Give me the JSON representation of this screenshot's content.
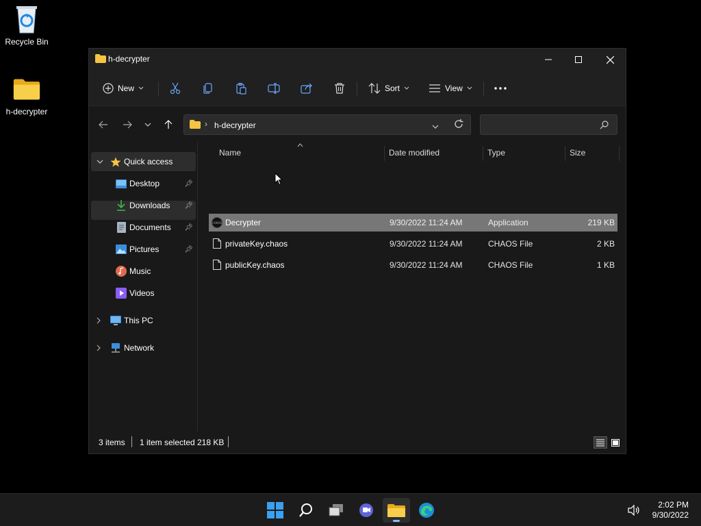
{
  "desktop": {
    "icons": [
      {
        "label": "Recycle Bin"
      },
      {
        "label": "h-decrypter"
      }
    ]
  },
  "window": {
    "title": "h-decrypter",
    "controls": {
      "minimize": "minimize-icon",
      "maximize": "maximize-icon",
      "close": "close-icon"
    }
  },
  "toolbar": {
    "new_label": "New",
    "sort_label": "Sort",
    "view_label": "View"
  },
  "address": {
    "path": "h-decrypter",
    "search_placeholder": ""
  },
  "nav": {
    "quick_access": "Quick access",
    "items": [
      {
        "label": "Desktop",
        "pinned": true
      },
      {
        "label": "Downloads",
        "pinned": true
      },
      {
        "label": "Documents",
        "pinned": true
      },
      {
        "label": "Pictures",
        "pinned": true
      },
      {
        "label": "Music",
        "pinned": false
      },
      {
        "label": "Videos",
        "pinned": false
      }
    ],
    "this_pc": "This PC",
    "network": "Network"
  },
  "columns": {
    "name": "Name",
    "date": "Date modified",
    "type": "Type",
    "size": "Size"
  },
  "files": [
    {
      "name": "Decrypter",
      "date": "9/30/2022 11:24 AM",
      "type": "Application",
      "size": "219 KB",
      "selected": true
    },
    {
      "name": "privateKey.chaos",
      "date": "9/30/2022 11:24 AM",
      "type": "CHAOS File",
      "size": "2 KB",
      "selected": false
    },
    {
      "name": "publicKey.chaos",
      "date": "9/30/2022 11:24 AM",
      "type": "CHAOS File",
      "size": "1 KB",
      "selected": false
    }
  ],
  "status": {
    "count": "3 items",
    "selection": "1 item selected",
    "sel_size": "218 KB"
  },
  "taskbar": {
    "time": "2:02 PM",
    "date": "9/30/2022"
  },
  "colors": {
    "folder": "#f4c542",
    "accent": "#0078d4",
    "selected_row": "#777777"
  }
}
